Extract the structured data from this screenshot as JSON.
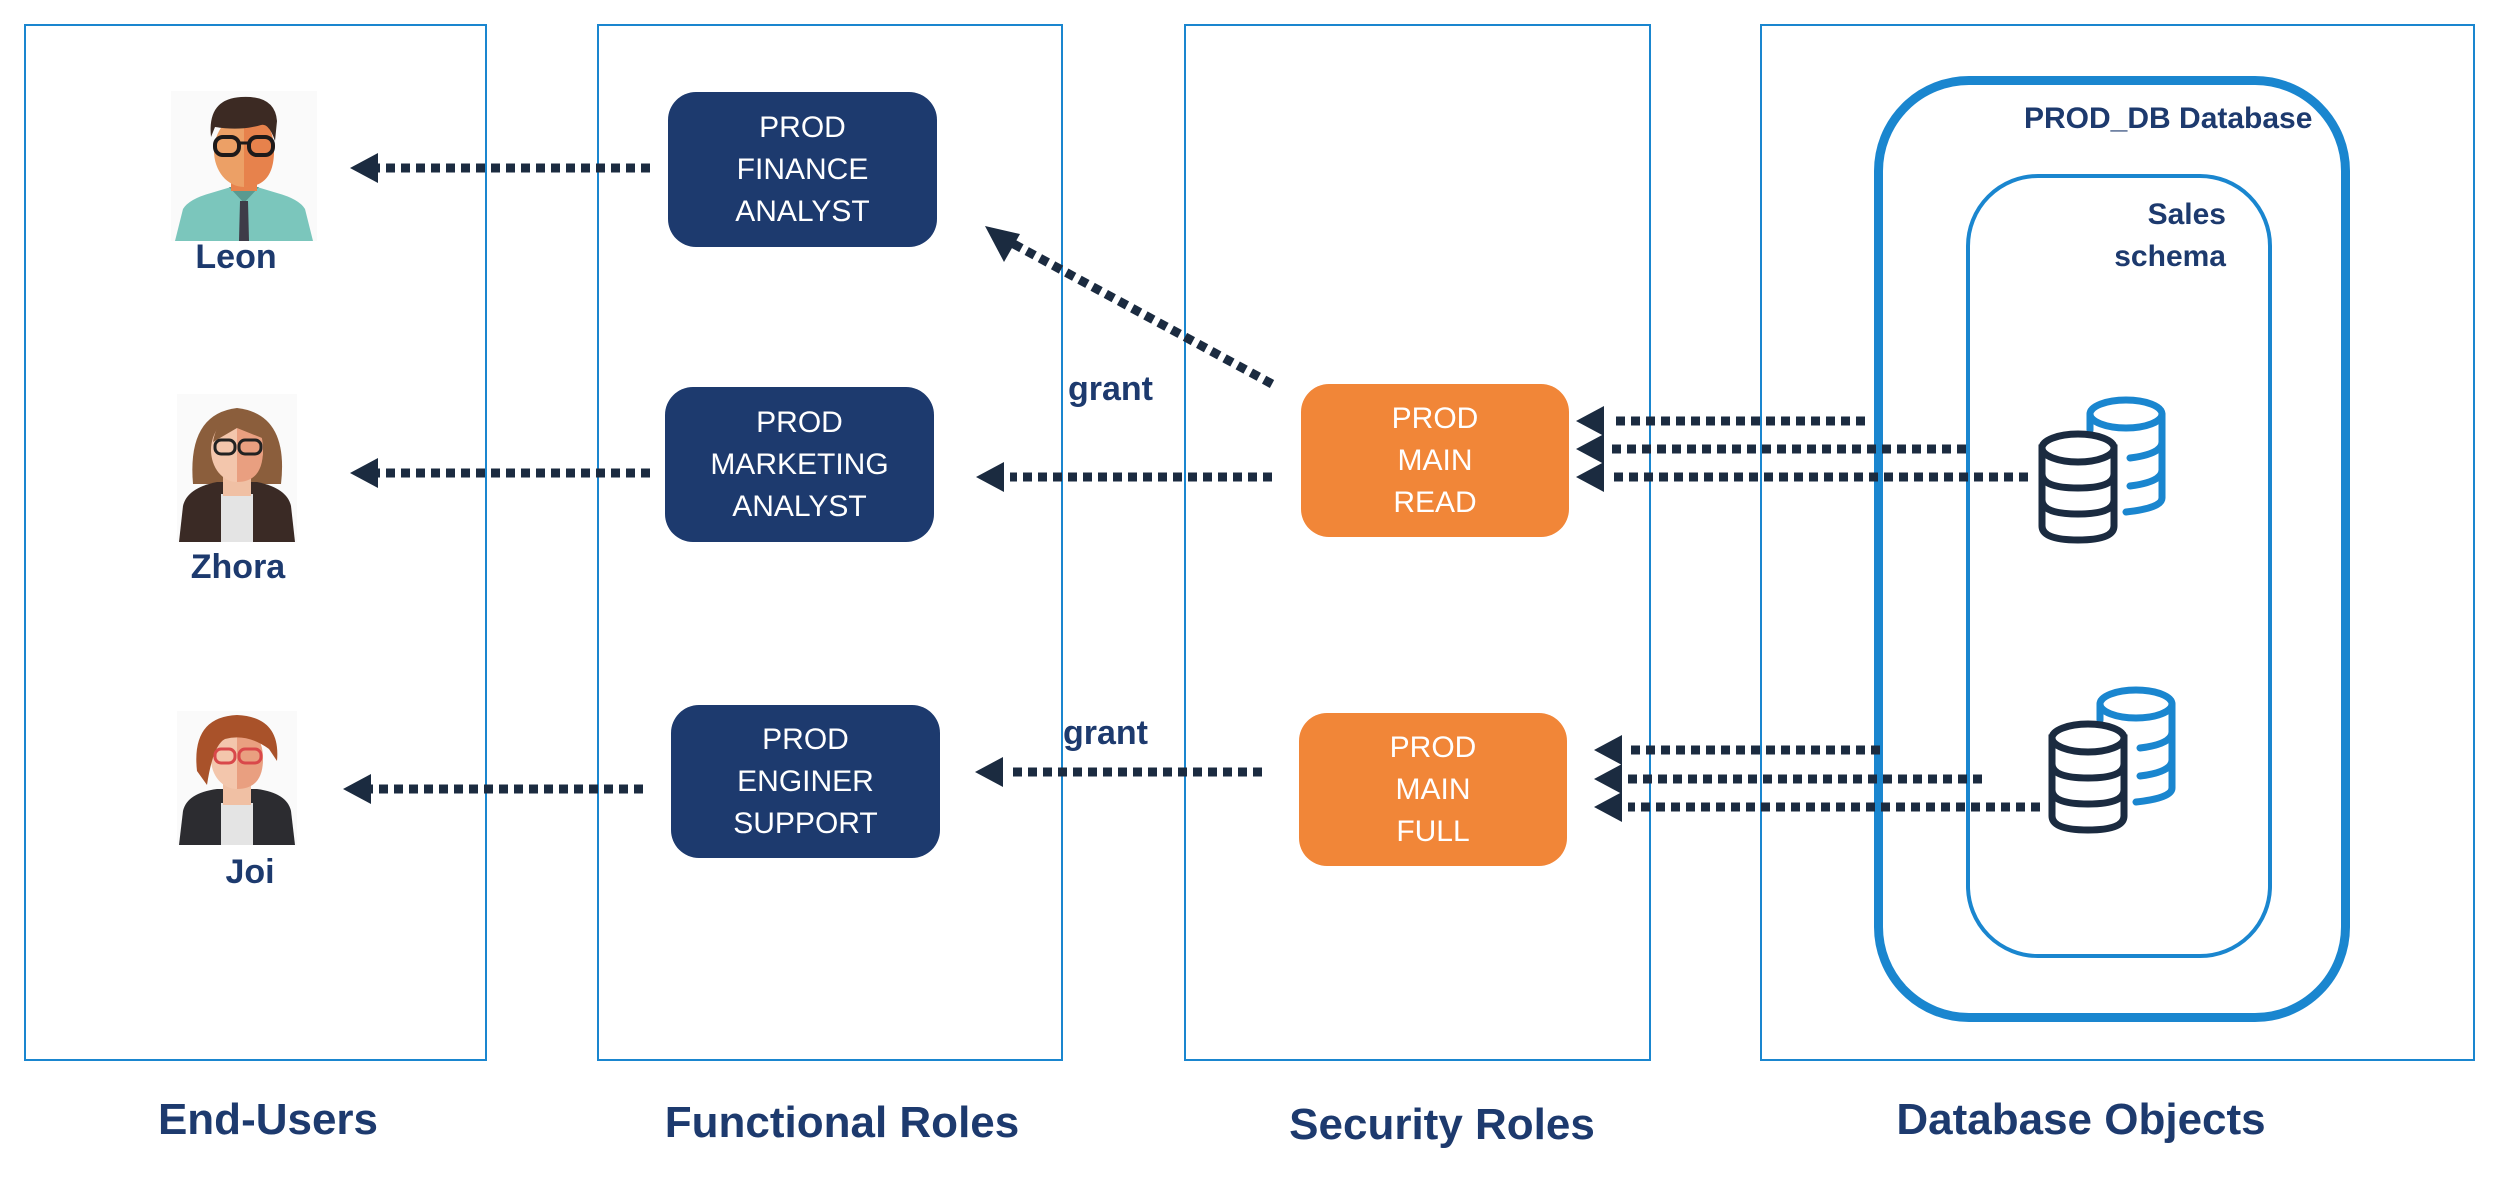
{
  "columns": [
    {
      "id": "end-users",
      "label": "End-Users"
    },
    {
      "id": "functional-roles",
      "label": "Functional Roles"
    },
    {
      "id": "security-roles",
      "label": "Security Roles"
    },
    {
      "id": "database-objects",
      "label": "Database Objects"
    }
  ],
  "users": [
    {
      "name": "Leon",
      "icon": "man-with-glasses-avatar"
    },
    {
      "name": "Zhora",
      "icon": "woman-long-hair-glasses-avatar"
    },
    {
      "name": "Joi",
      "icon": "woman-short-red-hair-glasses-avatar"
    }
  ],
  "functional_roles": [
    {
      "lines": [
        "PROD",
        "FINANCE",
        "ANALYST"
      ]
    },
    {
      "lines": [
        "PROD",
        "MARKETING",
        "ANALYST"
      ]
    },
    {
      "lines": [
        "PROD",
        "ENGINER",
        "SUPPORT"
      ]
    }
  ],
  "security_roles": [
    {
      "lines": [
        "PROD",
        "MAIN",
        "READ"
      ]
    },
    {
      "lines": [
        "PROD",
        "MAIN",
        "FULL"
      ]
    }
  ],
  "grant_labels": [
    "grant",
    "grant"
  ],
  "database": {
    "title": "PROD_DB Database",
    "schema_lines": [
      "Sales",
      "schema"
    ],
    "objects": [
      {
        "icon": "database-stack-icon"
      },
      {
        "icon": "database-stack-icon"
      }
    ]
  },
  "colors": {
    "column_border": "#1a86cf",
    "functional_role": "#1d3a6e",
    "security_role": "#f18638",
    "arrow": "#1b2b40",
    "label_text": "#1d3a6e"
  }
}
